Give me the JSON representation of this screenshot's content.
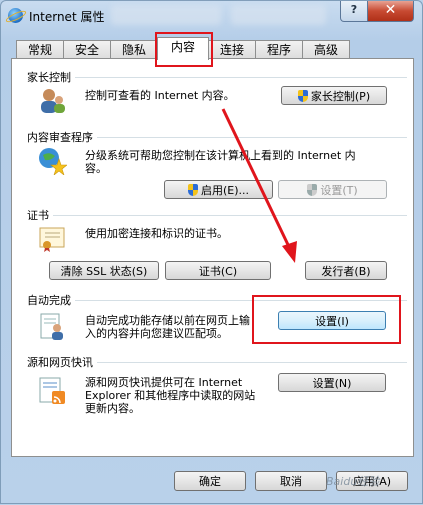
{
  "window": {
    "title": "Internet 属性",
    "help_glyph": "?",
    "close_glyph": "✕"
  },
  "tabs": [
    {
      "label": "常规"
    },
    {
      "label": "安全"
    },
    {
      "label": "隐私"
    },
    {
      "label": "内容",
      "active": true
    },
    {
      "label": "连接"
    },
    {
      "label": "程序"
    },
    {
      "label": "高级"
    }
  ],
  "parental": {
    "header": "家长控制",
    "desc": "控制可查看的 Internet 内容。",
    "button": "家长控制(P)"
  },
  "content_advisor": {
    "header": "内容审查程序",
    "desc_line1": "分级系统可帮助您控制在该计算机上看到的 Internet 内",
    "desc_line2": "容。",
    "enable_button": "启用(E)...",
    "settings_button": "设置(T)"
  },
  "certificates": {
    "header": "证书",
    "desc": "使用加密连接和标识的证书。",
    "clear_ssl_button": "清除 SSL 状态(S)",
    "certificates_button": "证书(C)",
    "publishers_button": "发行者(B)"
  },
  "autocomplete": {
    "header": "自动完成",
    "desc_line1": "自动完成功能存储以前在网页上输",
    "desc_line2": "入的内容并向您建议匹配项。",
    "settings_button": "设置(I)"
  },
  "feeds": {
    "header": "源和网页快讯",
    "desc_line1": "源和网页快讯提供可在 Internet",
    "desc_line2": "Explorer 和其他程序中读取的网站",
    "desc_line3": "更新内容。",
    "settings_button": "设置(N)"
  },
  "footer": {
    "ok": "确定",
    "cancel": "取消",
    "apply": "应用(A)"
  },
  "watermark": "Baidu经验",
  "colors": {
    "highlight_red": "#e0151c",
    "arrow_red": "#e0151c"
  }
}
